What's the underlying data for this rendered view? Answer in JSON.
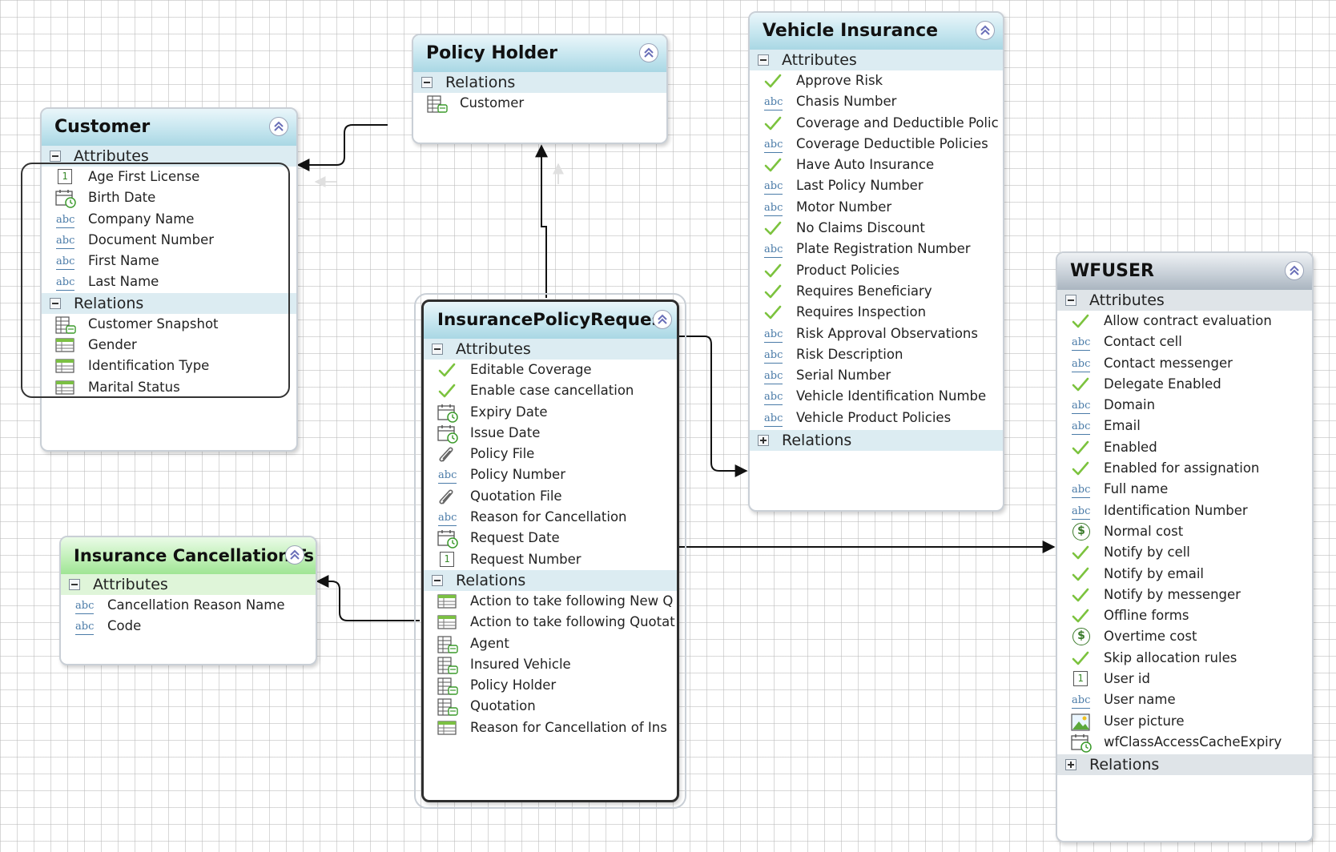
{
  "entities": {
    "policy_holder": {
      "title": "Policy Holder",
      "relations_label": "Relations",
      "relations": [
        {
          "label": "Customer",
          "icon": "entity-relation-icon"
        }
      ]
    },
    "customer": {
      "title": "Customer",
      "attributes_label": "Attributes",
      "attributes": [
        {
          "label": "Age First License",
          "icon": "number"
        },
        {
          "label": "Birth Date",
          "icon": "date"
        },
        {
          "label": "Company Name",
          "icon": "text"
        },
        {
          "label": "Document Number",
          "icon": "text"
        },
        {
          "label": "First Name",
          "icon": "text"
        },
        {
          "label": "Last Name",
          "icon": "text"
        }
      ],
      "relations_label": "Relations",
      "relations": [
        {
          "label": "Customer Snapshot",
          "icon": "entity"
        },
        {
          "label": "Gender",
          "icon": "table"
        },
        {
          "label": "Identification Type",
          "icon": "table"
        },
        {
          "label": "Marital Status",
          "icon": "table"
        }
      ]
    },
    "vehicle_insurance": {
      "title": "Vehicle Insurance",
      "attributes_label": "Attributes",
      "attributes": [
        {
          "label": "Approve Risk",
          "icon": "boolean"
        },
        {
          "label": "Chasis Number",
          "icon": "text"
        },
        {
          "label": "Coverage and Deductible Polic",
          "icon": "boolean"
        },
        {
          "label": "Coverage Deductible Policies",
          "icon": "text"
        },
        {
          "label": "Have Auto Insurance",
          "icon": "boolean"
        },
        {
          "label": "Last Policy Number",
          "icon": "text"
        },
        {
          "label": "Motor Number",
          "icon": "text"
        },
        {
          "label": "No Claims Discount",
          "icon": "boolean"
        },
        {
          "label": "Plate Registration Number",
          "icon": "text"
        },
        {
          "label": "Product Policies",
          "icon": "boolean"
        },
        {
          "label": "Requires Beneficiary",
          "icon": "boolean"
        },
        {
          "label": "Requires Inspection",
          "icon": "boolean"
        },
        {
          "label": "Risk Approval Observations",
          "icon": "text"
        },
        {
          "label": "Risk Description",
          "icon": "text"
        },
        {
          "label": "Serial Number",
          "icon": "text"
        },
        {
          "label": "Vehicle Identification Numbe",
          "icon": "text"
        },
        {
          "label": "Vehicle Product Policies",
          "icon": "text"
        }
      ],
      "relations_label": "Relations"
    },
    "insurance_policy_request": {
      "title": "InsurancePolicyRequest",
      "attributes_label": "Attributes",
      "attributes": [
        {
          "label": "Editable Coverage",
          "icon": "boolean"
        },
        {
          "label": "Enable case cancellation",
          "icon": "boolean"
        },
        {
          "label": "Expiry Date",
          "icon": "date"
        },
        {
          "label": "Issue Date",
          "icon": "date"
        },
        {
          "label": "Policy File",
          "icon": "file"
        },
        {
          "label": "Policy Number",
          "icon": "text"
        },
        {
          "label": "Quotation File",
          "icon": "file"
        },
        {
          "label": "Reason for Cancellation",
          "icon": "text"
        },
        {
          "label": "Request Date",
          "icon": "date"
        },
        {
          "label": "Request Number",
          "icon": "number"
        }
      ],
      "relations_label": "Relations",
      "relations": [
        {
          "label": "Action to take following New Q",
          "icon": "table"
        },
        {
          "label": "Action to take following Quotat",
          "icon": "table"
        },
        {
          "label": "Agent",
          "icon": "entity"
        },
        {
          "label": "Insured Vehicle",
          "icon": "entity"
        },
        {
          "label": "Policy Holder",
          "icon": "entity"
        },
        {
          "label": "Quotation",
          "icon": "entity"
        },
        {
          "label": "Reason for Cancellation of Ins",
          "icon": "table"
        }
      ]
    },
    "insurance_cancellation": {
      "title": "Insurance Cancellation F",
      "title_tail": "s",
      "attributes_label": "Attributes",
      "attributes": [
        {
          "label": "Cancellation Reason Name",
          "icon": "text"
        },
        {
          "label": "Code",
          "icon": "text"
        }
      ]
    },
    "wfuser": {
      "title": "WFUSER",
      "attributes_label": "Attributes",
      "attributes": [
        {
          "label": "Allow contract evaluation",
          "icon": "boolean"
        },
        {
          "label": "Contact cell",
          "icon": "text"
        },
        {
          "label": "Contact messenger",
          "icon": "text"
        },
        {
          "label": "Delegate Enabled",
          "icon": "boolean"
        },
        {
          "label": "Domain",
          "icon": "text"
        },
        {
          "label": "Email",
          "icon": "text"
        },
        {
          "label": "Enabled",
          "icon": "boolean"
        },
        {
          "label": "Enabled for assignation",
          "icon": "boolean"
        },
        {
          "label": "Full name",
          "icon": "text"
        },
        {
          "label": "Identification Number",
          "icon": "text"
        },
        {
          "label": "Normal cost",
          "icon": "currency"
        },
        {
          "label": "Notify by cell",
          "icon": "boolean"
        },
        {
          "label": "Notify by email",
          "icon": "boolean"
        },
        {
          "label": "Notify by messenger",
          "icon": "boolean"
        },
        {
          "label": "Offline forms",
          "icon": "boolean"
        },
        {
          "label": "Overtime cost",
          "icon": "currency"
        },
        {
          "label": "Skip allocation rules",
          "icon": "boolean"
        },
        {
          "label": "User id",
          "icon": "number"
        },
        {
          "label": "User name",
          "icon": "text"
        },
        {
          "label": "User picture",
          "icon": "image"
        },
        {
          "label": "wfClassAccessCacheExpiry",
          "icon": "date"
        }
      ],
      "relations_label": "Relations"
    }
  },
  "icon_glyphs": {
    "text": "abc",
    "number": "1",
    "currency": "$"
  },
  "colors": {
    "title_blue": "#a9d7e4",
    "title_green": "#9fe594",
    "title_gray": "#aab5c0",
    "check_green": "#7cc33e",
    "connector": "#111111"
  }
}
